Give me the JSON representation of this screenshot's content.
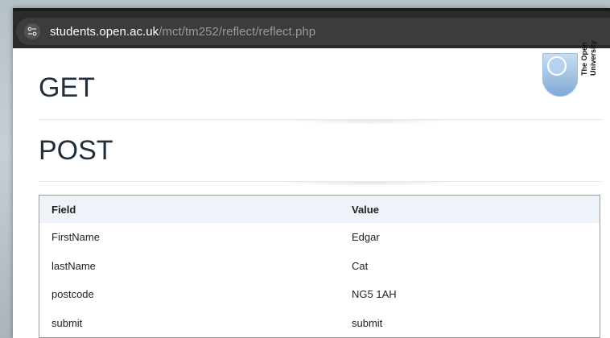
{
  "browser": {
    "url_host": "students.open.ac.uk",
    "url_path": "/mct/tm252/reflect/reflect.php",
    "site_icon": "site-settings-icon"
  },
  "logo": {
    "text_line1": "The Open",
    "text_line2": "University",
    "icon": "open-university-logo"
  },
  "sections": {
    "get_heading": "GET",
    "post_heading": "POST"
  },
  "table": {
    "headers": {
      "field": "Field",
      "value": "Value"
    },
    "rows": [
      {
        "field": "FirstName",
        "value": "Edgar"
      },
      {
        "field": "lastName",
        "value": "Cat"
      },
      {
        "field": "postcode",
        "value": "NG5 1AH"
      },
      {
        "field": "submit",
        "value": "submit"
      }
    ]
  },
  "colors": {
    "addressbar_bg": "#2b2b2b",
    "heading_text": "#1f2f3e",
    "table_header_bg": "#eef3fa",
    "logo_blue": "#7fa9d6"
  }
}
